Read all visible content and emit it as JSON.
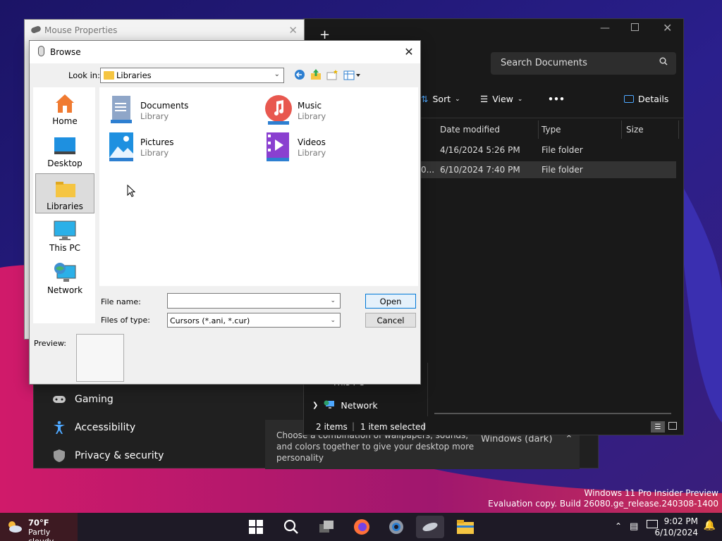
{
  "settings": {
    "items": [
      {
        "label": "Gaming",
        "icon": "gamepad-icon"
      },
      {
        "label": "Accessibility",
        "icon": "accessibility-icon"
      },
      {
        "label": "Privacy & security",
        "icon": "shield-icon"
      }
    ],
    "theme_desc": "Choose a combination of wallpapers, sounds, and colors together to give your desktop more personality",
    "theme_value": "Windows (dark)"
  },
  "explorer": {
    "search_placeholder": "Search Documents",
    "toolbar": {
      "sort": "Sort",
      "view": "View",
      "more": "•••",
      "details": "Details"
    },
    "columns": [
      "Date modified",
      "Type",
      "Size"
    ],
    "rows": [
      {
        "date": "4/16/2024 5:26 PM",
        "type": "File folder",
        "trunc": ""
      },
      {
        "date": "6/10/2024 7:40 PM",
        "type": "File folder",
        "trunc": "0..."
      }
    ],
    "nav": {
      "thispc": "This PC",
      "network": "Network"
    },
    "status": {
      "items": "2 items",
      "selected": "1 item selected"
    }
  },
  "mouse_properties": {
    "title": "Mouse Properties"
  },
  "browse": {
    "title": "Browse",
    "look_in_label": "Look in:",
    "look_in_value": "Libraries",
    "places": [
      {
        "label": "Home",
        "icon": "home-icon"
      },
      {
        "label": "Desktop",
        "icon": "desktop-icon"
      },
      {
        "label": "Libraries",
        "icon": "libraries-icon"
      },
      {
        "label": "This PC",
        "icon": "this-pc-icon"
      },
      {
        "label": "Network",
        "icon": "network-icon"
      }
    ],
    "files": [
      {
        "name": "Documents",
        "sub": "Library",
        "icon": "documents-icon"
      },
      {
        "name": "Music",
        "sub": "Library",
        "icon": "music-icon"
      },
      {
        "name": "Pictures",
        "sub": "Library",
        "icon": "pictures-icon"
      },
      {
        "name": "Videos",
        "sub": "Library",
        "icon": "videos-icon"
      }
    ],
    "file_name_label": "File name:",
    "file_name_value": "",
    "file_type_label": "Files of type:",
    "file_type_value": "Cursors (*.ani, *.cur)",
    "open": "Open",
    "cancel": "Cancel",
    "preview_label": "Preview:"
  },
  "watermark": {
    "line1": "Windows 11 Pro Insider Preview",
    "line2": "Evaluation copy. Build 26080.ge_release.240308-1400"
  },
  "taskbar": {
    "weather_temp": "70°F",
    "weather_desc": "Partly cloudy",
    "time": "9:02 PM",
    "date": "6/10/2024"
  },
  "colors": {
    "accent": "#0078d7",
    "dark_bg": "#191919",
    "dialog_bg": "#f0f0f0"
  }
}
